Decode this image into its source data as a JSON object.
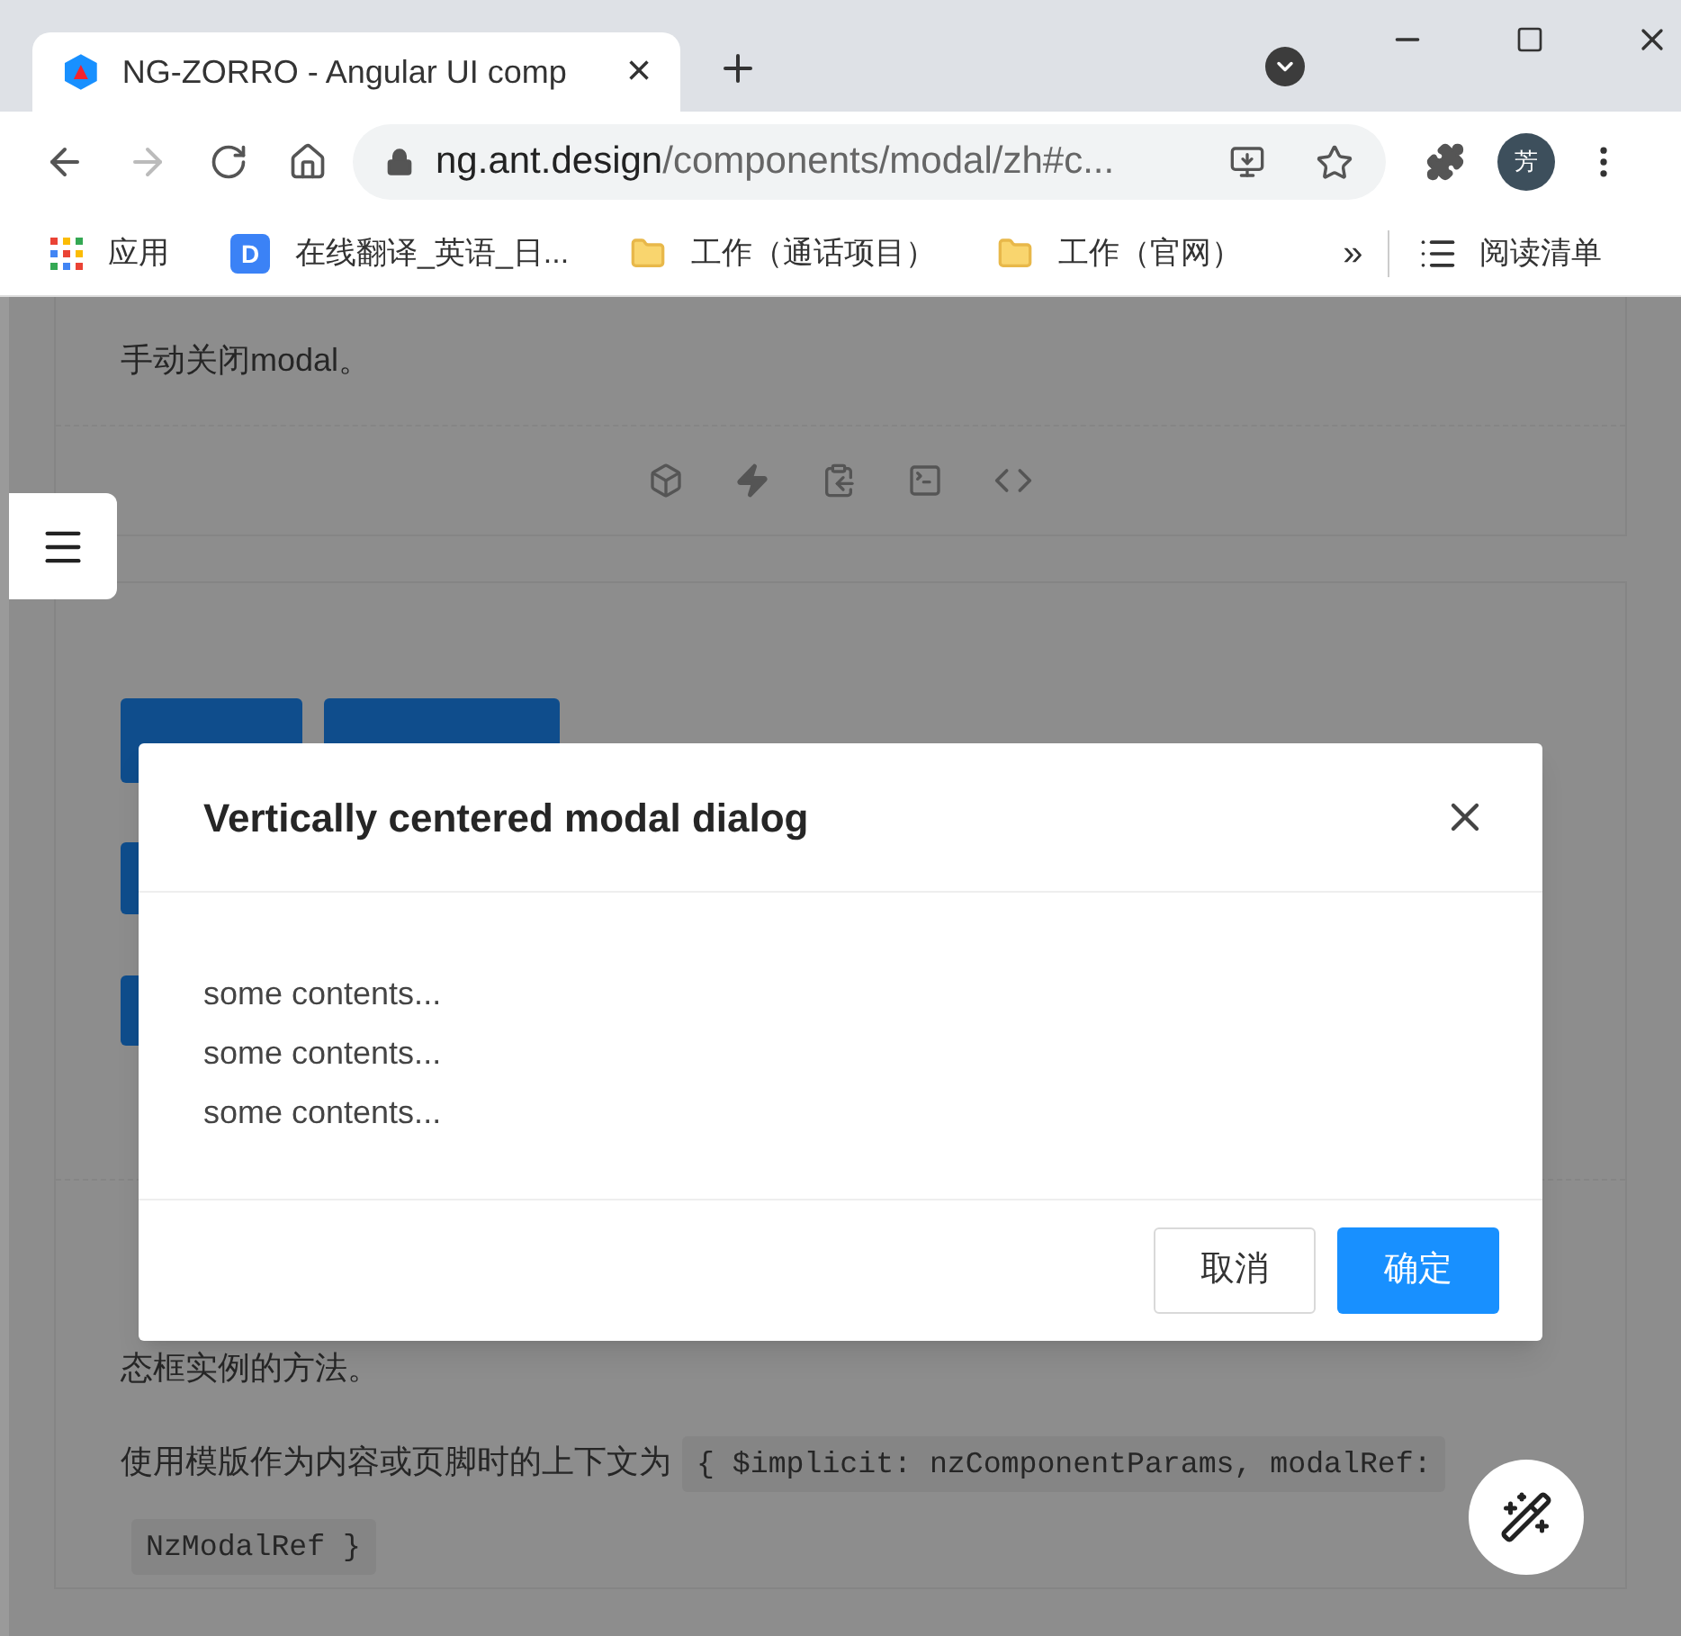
{
  "browser": {
    "tab_title": "NG-ZORRO - Angular UI comp",
    "tab_close": "×",
    "url_host": "ng.ant.design",
    "url_path": "/components/modal/zh#c...",
    "avatar": "芳",
    "bookmarks": [
      {
        "kind": "apps",
        "label": "应用"
      },
      {
        "kind": "site",
        "label": "在线翻译_英语_日...",
        "badge": "D"
      },
      {
        "kind": "folder",
        "label": "工作（通话项目）"
      },
      {
        "kind": "folder",
        "label": "工作（官网）"
      }
    ],
    "overflow": "»",
    "reading_list": "阅读清单"
  },
  "page": {
    "intro": "手动关闭modal。",
    "description": [
      {
        "text": "态框实例的方法。"
      },
      {
        "text": "使用模版作为内容或页脚时的上下文为",
        "code": "{ $implicit: nzComponentParams, modalRef: NzModalRef }"
      }
    ]
  },
  "modal": {
    "title": "Vertically centered modal dialog",
    "body": [
      "some contents...",
      "some contents...",
      "some contents..."
    ],
    "cancel": "取消",
    "ok": "确定"
  }
}
